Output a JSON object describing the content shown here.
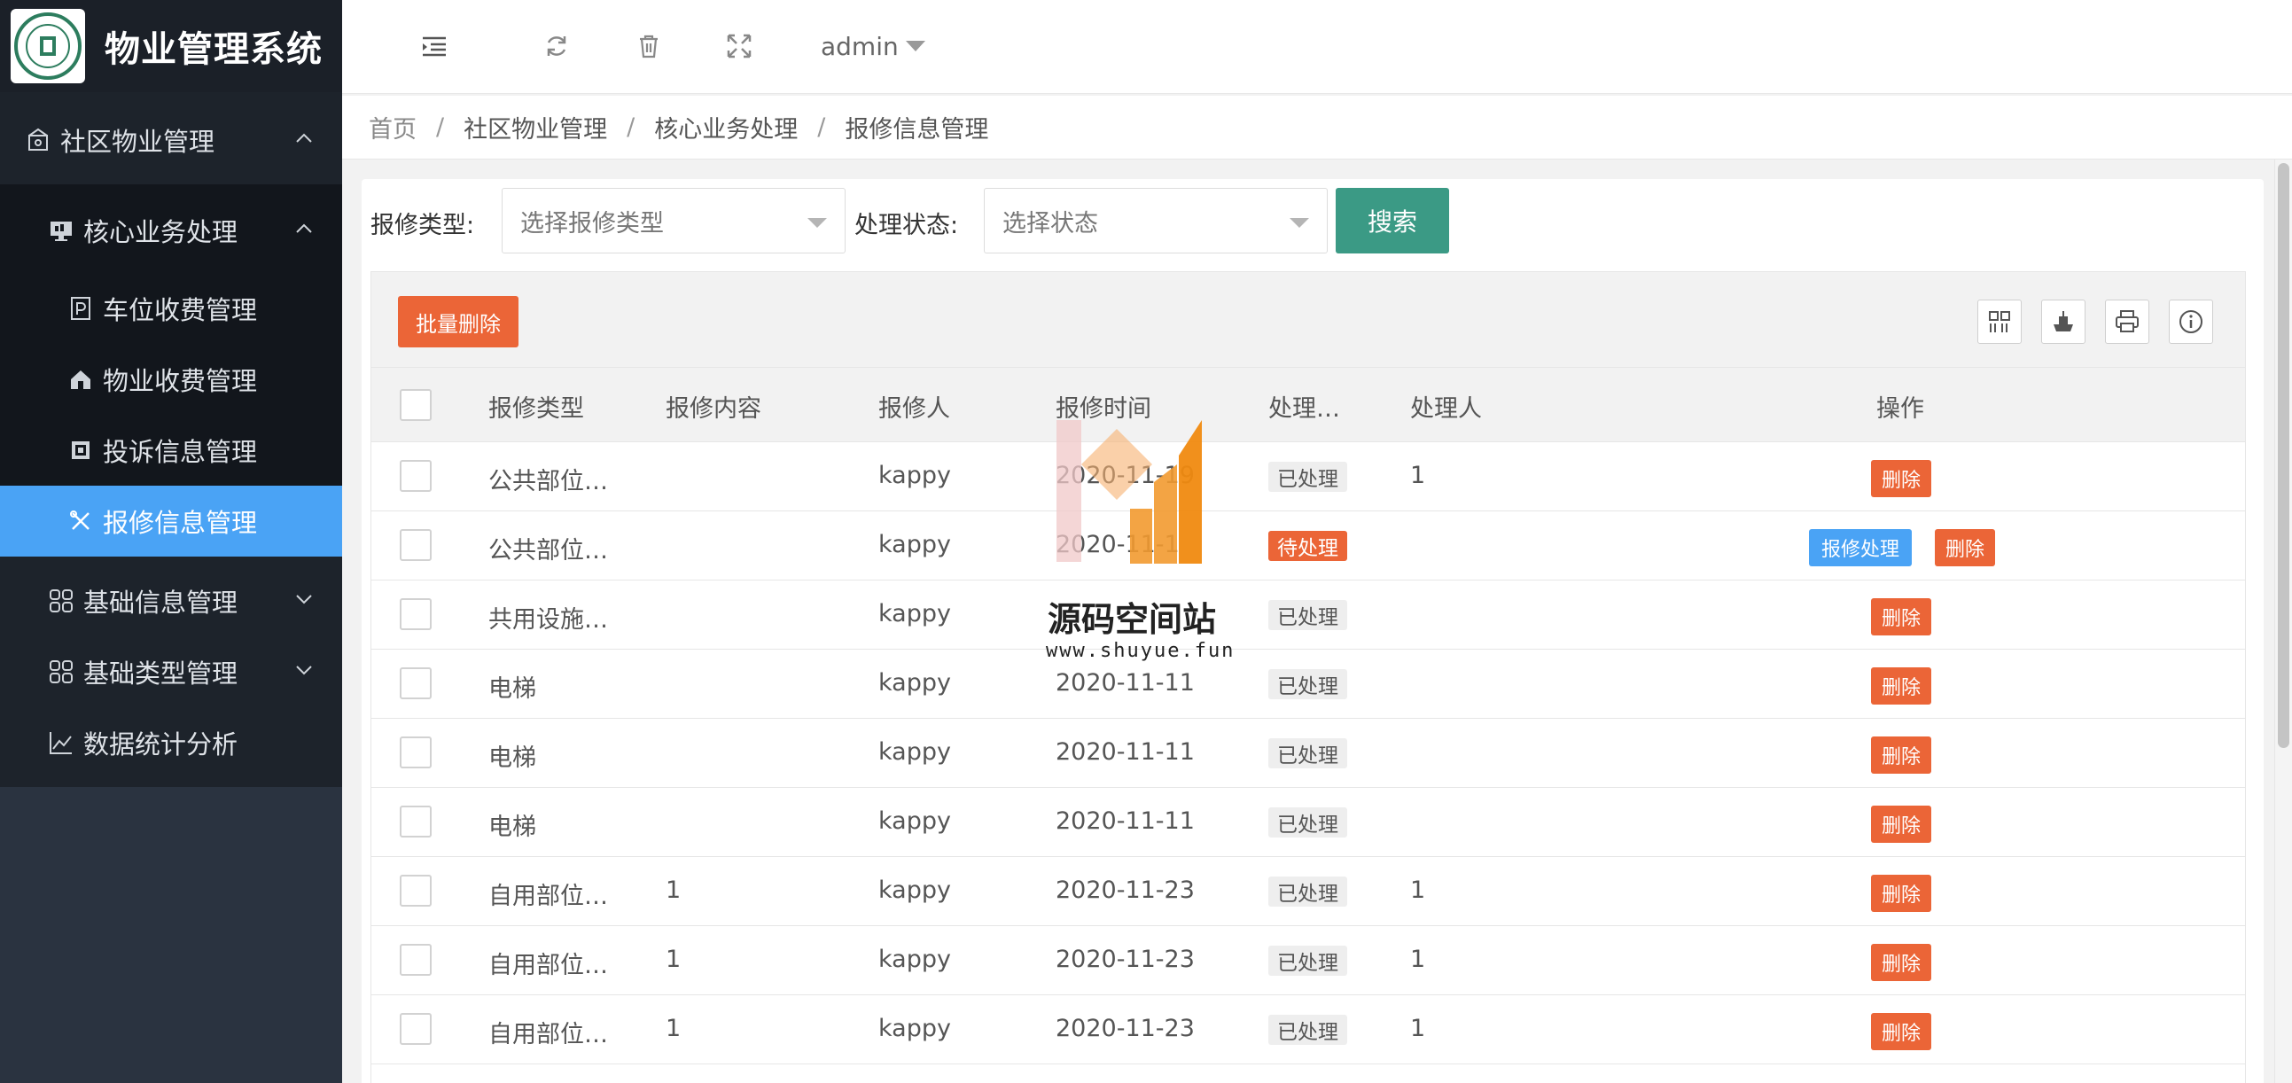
{
  "app": {
    "title": "物业管理系统"
  },
  "sidebar": {
    "group": {
      "label": "社区物业管理"
    },
    "sub_group": {
      "label": "核心业务处理"
    },
    "items": [
      {
        "label": "车位收费管理"
      },
      {
        "label": "物业收费管理"
      },
      {
        "label": "投诉信息管理"
      },
      {
        "label": "报修信息管理"
      }
    ],
    "others": [
      {
        "label": "基础信息管理"
      },
      {
        "label": "基础类型管理"
      },
      {
        "label": "数据统计分析"
      }
    ]
  },
  "header": {
    "user": "admin"
  },
  "breadcrumb": [
    "首页",
    "社区物业管理",
    "核心业务处理",
    "报修信息管理"
  ],
  "filters": {
    "type_label": "报修类型:",
    "type_placeholder": "选择报修类型",
    "status_label": "处理状态:",
    "status_placeholder": "选择状态",
    "search_button": "搜索"
  },
  "toolbar": {
    "batch_delete": "批量删除"
  },
  "table": {
    "columns": [
      "报修类型",
      "报修内容",
      "报修人",
      "报修时间",
      "处理…",
      "处理人",
      "操作"
    ],
    "rows": [
      {
        "type": "公共部位…",
        "content": "",
        "reporter": "kappy",
        "time": "2020-11-19",
        "status": "已处理",
        "handler": "1"
      },
      {
        "type": "公共部位…",
        "content": "",
        "reporter": "kappy",
        "time": "2020-11-1",
        "status": "待处理",
        "handler": ""
      },
      {
        "type": "共用设施…",
        "content": "",
        "reporter": "kappy",
        "time": "",
        "status": "已处理",
        "handler": ""
      },
      {
        "type": "电梯",
        "content": "",
        "reporter": "kappy",
        "time": "2020-11-11",
        "status": "已处理",
        "handler": ""
      },
      {
        "type": "电梯",
        "content": "",
        "reporter": "kappy",
        "time": "2020-11-11",
        "status": "已处理",
        "handler": ""
      },
      {
        "type": "电梯",
        "content": "",
        "reporter": "kappy",
        "time": "2020-11-11",
        "status": "已处理",
        "handler": ""
      },
      {
        "type": "自用部位…",
        "content": "1",
        "reporter": "kappy",
        "time": "2020-11-23",
        "status": "已处理",
        "handler": "1"
      },
      {
        "type": "自用部位…",
        "content": "1",
        "reporter": "kappy",
        "time": "2020-11-23",
        "status": "已处理",
        "handler": "1"
      },
      {
        "type": "自用部位…",
        "content": "1",
        "reporter": "kappy",
        "time": "2020-11-23",
        "status": "已处理",
        "handler": "1"
      }
    ],
    "action_delete": "删除",
    "action_process": "报修处理"
  },
  "watermark": {
    "name": "源码空间站",
    "url": "www.shuyue.fun"
  },
  "colors": {
    "accent": "#4aa3f5",
    "danger": "#eb6537",
    "search": "#3b9a85",
    "sidebar": "#2a3340"
  }
}
